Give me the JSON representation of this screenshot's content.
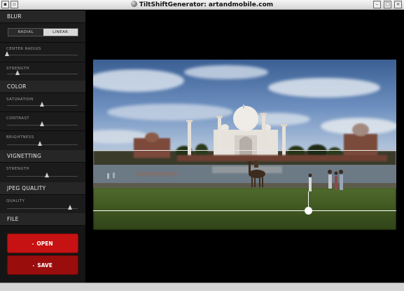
{
  "window": {
    "title": "TiltShiftGenerator: artandmobile.com"
  },
  "sidebar": {
    "blur": {
      "header": "BLUR",
      "mode_radial": "RADIAL",
      "mode_linear": "LINEAR",
      "selected_mode": "LINEAR",
      "center_radius_label": "CENTER RADIUS",
      "center_radius_value": 0.0,
      "strength_label": "STRENGTH",
      "strength_value": 0.15
    },
    "color": {
      "header": "COLOR",
      "saturation_label": "SATURATION",
      "saturation_value": 0.5,
      "contrast_label": "CONTRAST",
      "contrast_value": 0.5,
      "brightness_label": "BRIGHTNESS",
      "brightness_value": 0.47
    },
    "vignetting": {
      "header": "VIGNETTING",
      "strength_label": "STRENGTH",
      "strength_value": 0.57
    },
    "jpeg": {
      "header": "JPEG QUALITY",
      "quality_label": "QUALITY",
      "quality_value": 0.9
    },
    "file": {
      "header": "FILE",
      "open_label": "OPEN",
      "save_label": "SAVE",
      "arrow_glyph": "▸"
    }
  },
  "colors": {
    "open_button": "#c61212",
    "save_button": "#990d0d",
    "panel_bg": "#151515",
    "section_header_bg": "#262626"
  },
  "icons": {
    "window_menu": "window-menu-icon",
    "sticky": "sticky-icon",
    "minimize": "minimize-icon",
    "maximize": "maximize-icon",
    "close": "close-icon",
    "app": "app-icon"
  }
}
